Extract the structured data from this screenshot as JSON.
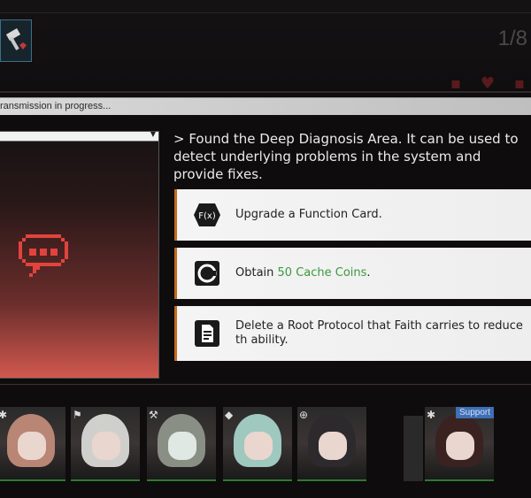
{
  "header": {
    "counter": "1/8",
    "skill_icon": "hammer-heart-icon",
    "status_icons": [
      "status-icon-1",
      "status-icon-2",
      "status-icon-3"
    ]
  },
  "transmission": {
    "text": "ransmission in progress..."
  },
  "event": {
    "description": "> Found the Deep Diagnosis Area. It can be used to detect underlying problems in the system and provide fixes."
  },
  "options": [
    {
      "icon": "function-card-icon",
      "label": "Upgrade a Function Card."
    },
    {
      "icon": "cache-coin-icon",
      "label_prefix": "Obtain ",
      "label_highlight": "50 Cache Coins",
      "label_suffix": "."
    },
    {
      "icon": "document-icon",
      "label": "Delete a Root Protocol that Faith carries to reduce th ability."
    }
  ],
  "roster": {
    "support_label": "Support"
  },
  "colors": {
    "accent_orange": "#c46a1a",
    "coin_green": "#3a9a3a",
    "panel_red": "#d0584e"
  }
}
